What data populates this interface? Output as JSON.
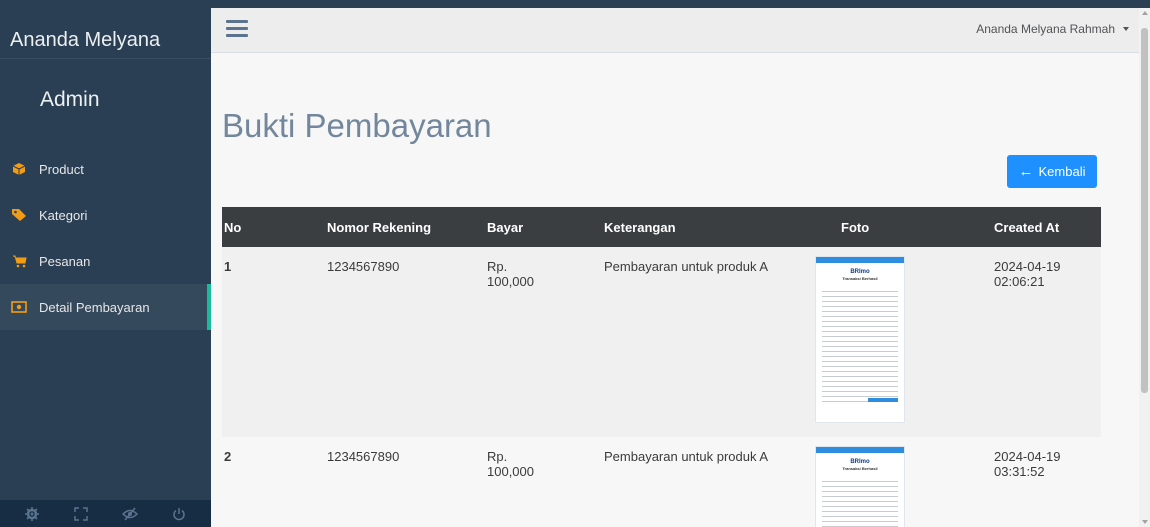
{
  "sidebar": {
    "brand": "Ananda Melyana",
    "role": "Admin",
    "items": [
      {
        "label": "Product",
        "icon": "cube-icon"
      },
      {
        "label": "Kategori",
        "icon": "tag-icon"
      },
      {
        "label": "Pesanan",
        "icon": "cart-icon"
      },
      {
        "label": "Detail Pembayaran",
        "icon": "money-icon"
      }
    ],
    "footer": [
      "gear-icon",
      "fullscreen-icon",
      "eye-slash-icon",
      "power-icon"
    ]
  },
  "topnav": {
    "user": "Ananda Melyana Rahmah"
  },
  "main": {
    "title": "Bukti Pembayaran",
    "back_button": "Kembali"
  },
  "table": {
    "headers": [
      "No",
      "Nomor Rekening",
      "Bayar",
      "Keterangan",
      "Foto",
      "Created At"
    ],
    "rows": [
      {
        "no": "1",
        "rekening": "1234567890",
        "bayar": "Rp. 100,000",
        "keterangan": "Pembayaran untuk produk A",
        "created": "2024-04-19 02:06:21"
      },
      {
        "no": "2",
        "rekening": "1234567890",
        "bayar": "Rp. 100,000",
        "keterangan": "Pembayaran untuk produk A",
        "created": "2024-04-19 03:31:52"
      }
    ],
    "receipt": {
      "brand": "BRImo",
      "title": "Transaksi Berhasil"
    }
  },
  "colors": {
    "sidebar": "#2a3f54",
    "accent": "#1abb9c",
    "button": "#1e90ff",
    "icon": "#f39c12"
  }
}
